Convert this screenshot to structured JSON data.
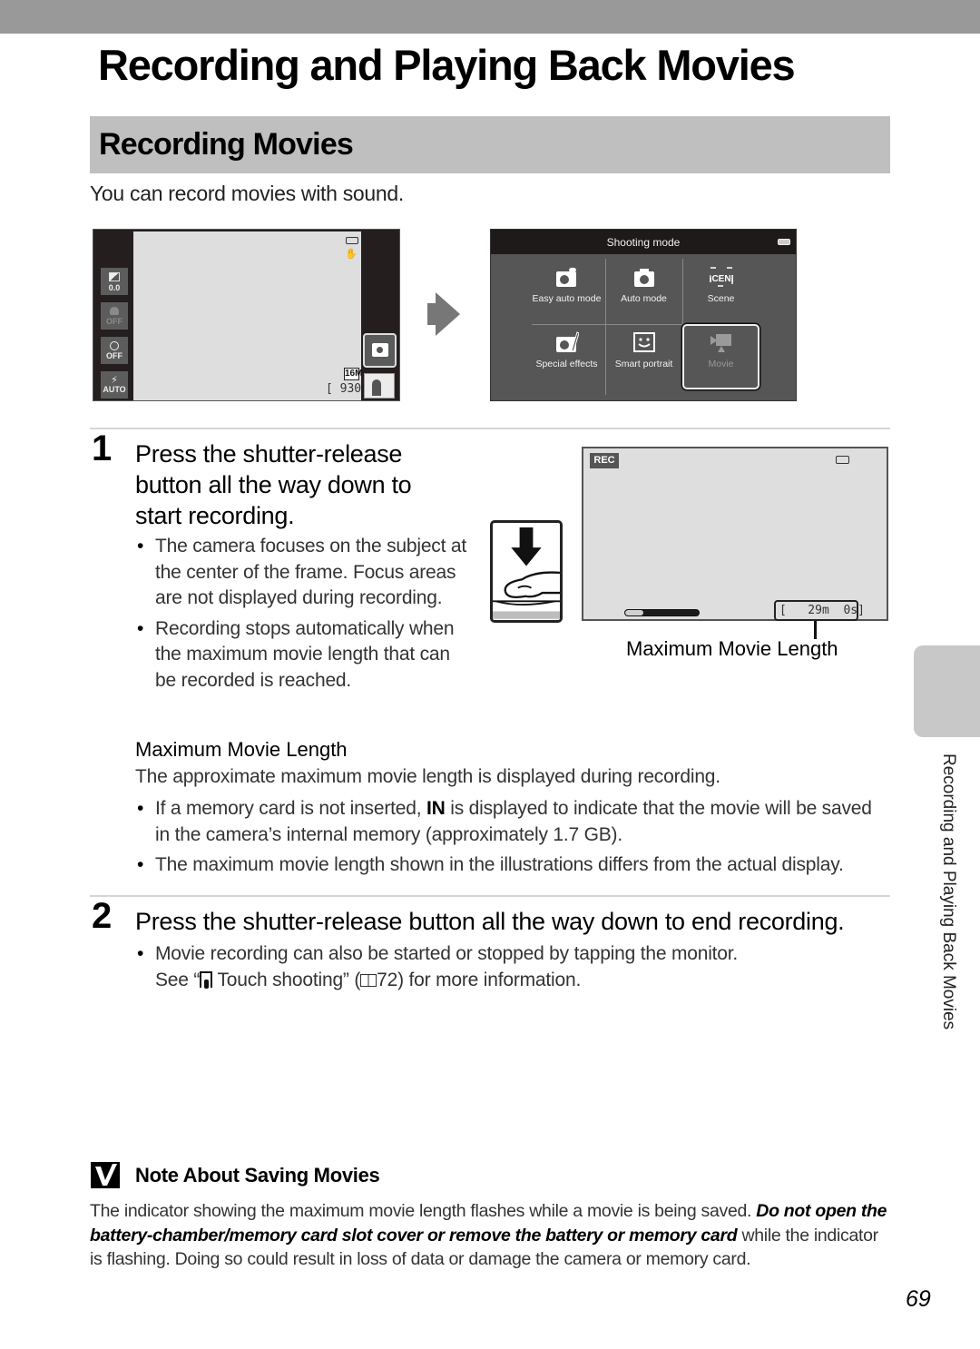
{
  "chapter": {
    "title": "Recording and Playing Back Movies"
  },
  "section": {
    "title": "Recording Movies",
    "intro": "You can record movies with sound."
  },
  "screen_shooting": {
    "left_buttons": [
      {
        "name": "exposure-compensation",
        "label": "0.0"
      },
      {
        "name": "macro-off",
        "label": "OFF"
      },
      {
        "name": "self-timer-off",
        "label": "OFF"
      },
      {
        "name": "flash-auto",
        "label": "AUTO"
      }
    ],
    "image_size": "16M",
    "shots_remaining": "[  930]"
  },
  "screen_mode_menu": {
    "header": "Shooting mode",
    "modes": [
      {
        "icon": "easy-auto-icon",
        "label": "Easy auto mode",
        "enabled": true
      },
      {
        "icon": "camera-icon",
        "label": "Auto mode",
        "enabled": true
      },
      {
        "icon": "scene-icon",
        "label": "Scene",
        "enabled": true
      },
      {
        "icon": "special-effects-icon",
        "label": "Special effects",
        "enabled": true
      },
      {
        "icon": "smart-portrait-icon",
        "label": "Smart portrait",
        "enabled": true
      },
      {
        "icon": "movie-icon",
        "label": "Movie",
        "enabled": false,
        "selected": true
      }
    ]
  },
  "step1": {
    "number": "1",
    "heading": [
      "Press the shutter-release",
      "button all the way down to",
      "start recording."
    ],
    "bullets": [
      "The camera focuses on the subject at the center of the frame. Focus areas are not displayed during recording.",
      "Recording stops automatically when the maximum movie length that can be recorded is reached."
    ]
  },
  "rec_screen": {
    "rec_label": "REC",
    "progress_fraction": 0.25,
    "remaining": "[   29m  0s]",
    "callout": "Maximum Movie Length"
  },
  "max_length": {
    "heading": "Maximum Movie Length",
    "paragraph": "The approximate maximum movie length is displayed during recording.",
    "bullet1_pre": "If a memory card is not inserted, ",
    "bullet1_bold": "IN",
    "bullet1_post": " is displayed to indicate that the movie will be saved in the camera’s internal memory (approximately 1.7 GB).",
    "bullet2": "The maximum movie length shown in the illustrations differs from the actual display."
  },
  "step2": {
    "number": "2",
    "heading": "Press the shutter-release button all the way down to end recording.",
    "bullet_line1": "Movie recording can also be started or stopped by tapping the monitor.",
    "bullet_line2_pre": "See “",
    "bullet_line2_icon": "touch-shooting-icon",
    "bullet_line2_mid": " Touch shooting” (",
    "bullet_line2_ref_icon": "book-icon",
    "bullet_line2_ref": "72) for more information."
  },
  "note": {
    "title": "Note About Saving Movies",
    "body_pre": "The indicator showing the maximum movie length flashes while a movie is being saved. ",
    "body_bold": "Do not open the battery-chamber/memory card slot cover or remove the battery or memory card",
    "body_post": " while the indicator is flashing. Doing so could result in loss of data or damage the camera or memory card."
  },
  "side_tab": {
    "label": "Recording and Playing Back Movies"
  },
  "page_number": "69"
}
